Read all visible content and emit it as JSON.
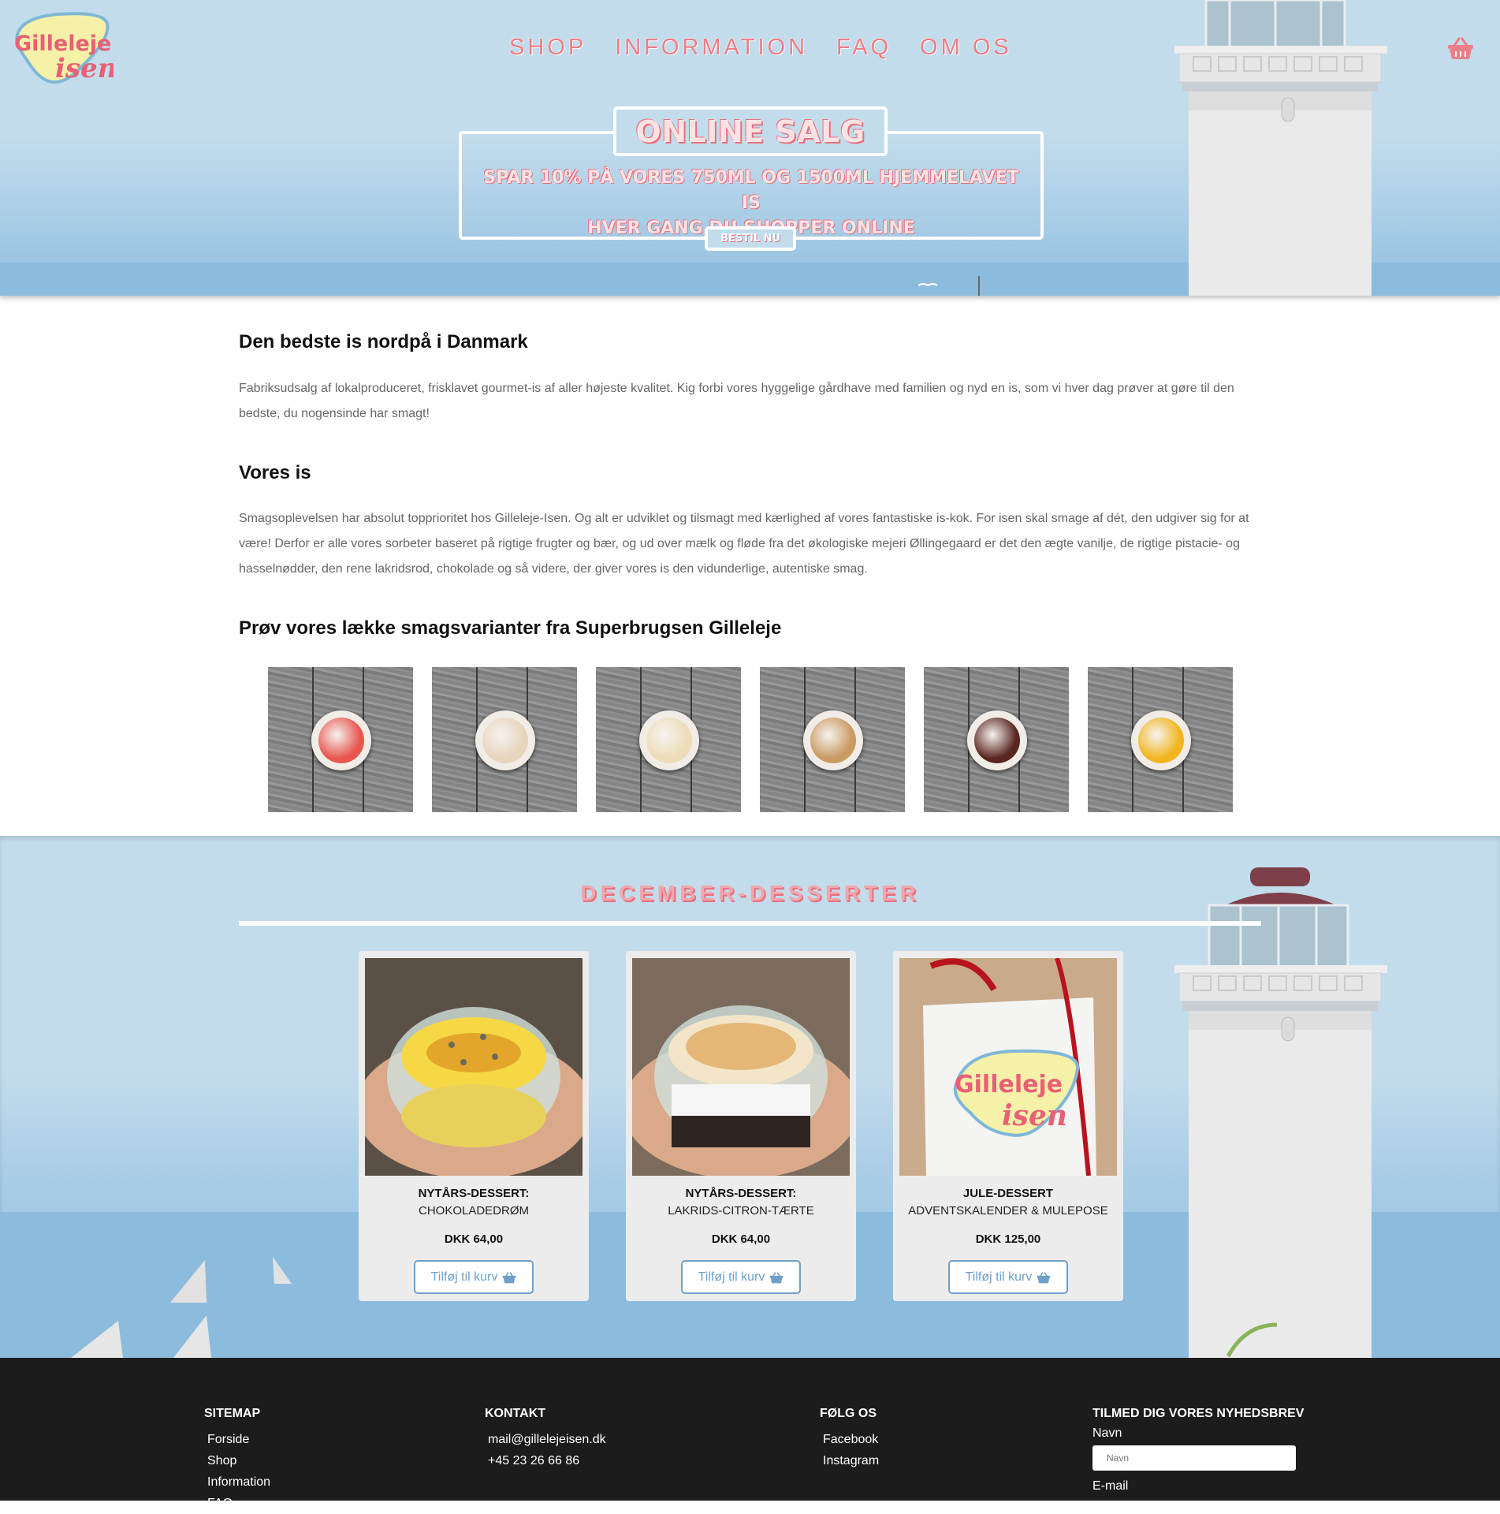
{
  "header": {
    "logo_line1": "Gilleleje",
    "logo_line2": "isen",
    "nav": [
      "SHOP",
      "INFORMATION",
      "FAQ",
      "OM OS"
    ]
  },
  "promo": {
    "title": "ONLINE SALG",
    "line1": "SPAR 10% PÅ VORES 750ML OG 1500ML HJEMMELAVET IS",
    "line2": "HVER GANG DU SHOPPER ONLINE",
    "button": "BESTIL NU"
  },
  "intro": {
    "heading": "Den bedste is nordpå i Danmark",
    "text": "Fabriksudsalg af lokalproduceret, frisklavet gourmet-is af aller højeste kvalitet. Kig forbi vores hyggelige gårdhave med familien og nyd en is, som vi hver dag prøver at gøre til den bedste, du nogensinde har smagt!"
  },
  "vores_is": {
    "heading": "Vores is",
    "text": "Smagsoplevelsen har absolut topprioritet hos Gilleleje-Isen. Og alt er udviklet og tilsmagt med kærlighed af vores fantastiske is-kok. For isen skal smage af dét, den udgiver sig for at være! Derfor er alle vores sorbeter baseret på rigtige frugter og bær, og ud over mælk og fløde fra det økologiske mejeri Øllingegaard er det den ægte vanilje, de rigtige pistacie- og hasselnødder, den rene lakridsrod, chokolade og så videre, der giver vores is den vidunderlige, autentiske smag."
  },
  "flavors": {
    "heading": "Prøv vores lække smagsvarianter fra Superbrugsen Gilleleje",
    "scoop_colors": [
      "#e8564f",
      "#e6d4bc",
      "#eddcb8",
      "#c99a62",
      "#5a2620",
      "#f2b51e"
    ]
  },
  "december": {
    "title": "DECEMBER-DESSERTER",
    "products": [
      {
        "line1": "NYTÅRS-DESSERT:",
        "line2": "CHOKOLADEDRØM",
        "price": "DKK 64,00",
        "button": "Tilføj til kurv"
      },
      {
        "line1": "NYTÅRS-DESSERT:",
        "line2": "LAKRIDS-CITRON-TÆRTE",
        "price": "DKK 64,00",
        "button": "Tilføj til kurv"
      },
      {
        "line1": "JULE-DESSERT",
        "line2": "ADVENTSKALENDER & MULEPOSE",
        "price": "DKK 125,00",
        "button": "Tilføj til kurv"
      }
    ]
  },
  "footer": {
    "sitemap": {
      "heading": "SITEMAP",
      "links": [
        "Forside",
        "Shop",
        "Information",
        "FAQ"
      ]
    },
    "kontakt": {
      "heading": "KONTAKT",
      "email": "mail@gillelejeisen.dk",
      "phone": "+45 23 26 66 86"
    },
    "folg": {
      "heading": "FØLG OS",
      "links": [
        "Facebook",
        "Instagram"
      ]
    },
    "newsletter": {
      "heading": "TILMED DIG VORES NYHEDSBREV",
      "name_label": "Navn",
      "name_placeholder": "Navn",
      "email_label": "E-mail"
    }
  },
  "colors": {
    "accent_pink": "#ef7d86",
    "sky": "#c3dcec",
    "sea": "#8cbcdd",
    "footer": "#1c1c1c",
    "button_blue": "#6fa0c8"
  }
}
